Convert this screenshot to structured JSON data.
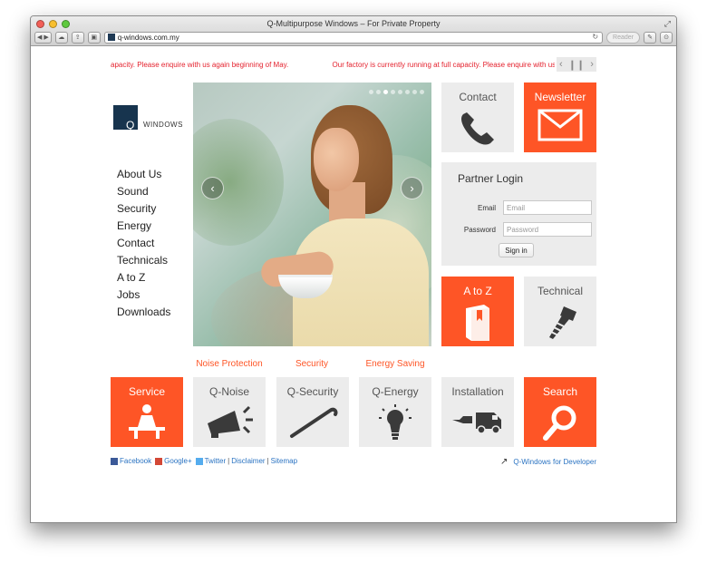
{
  "window": {
    "title": "Q-Multipurpose Windows – For Private Property",
    "url": "q-windows.com.my",
    "reader_label": "Reader"
  },
  "ticker": {
    "messages": [
      "apacity. Please enquire with us again beginning of May.",
      "Our factory is currently running at full capacity. Please enquire with us again b"
    ]
  },
  "logo": {
    "text": "WINDOWS",
    "mark": "Q"
  },
  "nav": {
    "items": [
      "About Us",
      "Sound",
      "Security",
      "Energy",
      "Contact",
      "Technicals",
      "A to Z",
      "Jobs",
      "Downloads"
    ]
  },
  "hero": {
    "slide_count": 8,
    "active_slide": 3
  },
  "tiles": {
    "contact": "Contact",
    "newsletter": "Newsletter",
    "atoz": "A to Z",
    "technical": "Technical",
    "service": "Service",
    "qnoise": "Q-Noise",
    "qsecurity": "Q-Security",
    "qenergy": "Q-Energy",
    "installation": "Installation",
    "search": "Search"
  },
  "categories": {
    "noise": "Noise Protection",
    "security": "Security",
    "energy": "Energy Saving"
  },
  "login": {
    "title": "Partner Login",
    "email_label": "Email",
    "email_placeholder": "Email",
    "password_label": "Password",
    "password_placeholder": "Password",
    "signin_label": "Sign in"
  },
  "footer": {
    "facebook": "Facebook",
    "google": "Google+",
    "twitter": "Twitter",
    "disclaimer": "Disclaimer",
    "sitemap": "Sitemap",
    "sep": "|",
    "developer": "Q-Windows for Developer"
  },
  "colors": {
    "accent": "#fe5526",
    "tile_gray": "#ececec",
    "ticker_red": "#e4222e",
    "link_blue": "#2a73c2"
  }
}
